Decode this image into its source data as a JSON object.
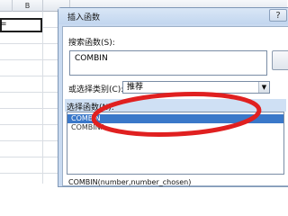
{
  "sheet": {
    "column_label": "B",
    "cell_text": "="
  },
  "dialog": {
    "title": "插入函数",
    "close_label": "?"
  },
  "search": {
    "label": "搜索函数(S):",
    "value": "COMBIN"
  },
  "category": {
    "label": "或选择类别(C):",
    "selected": "推荐"
  },
  "function_list": {
    "label": "选择函数(N):",
    "items": [
      "COMBIN",
      "COMBINA"
    ]
  },
  "signature": "COMBIN(number,number_chosen)",
  "colors": {
    "annotation": "#e02020",
    "selection": "#3a78c9",
    "dialog_bg": "#c9daf0"
  }
}
